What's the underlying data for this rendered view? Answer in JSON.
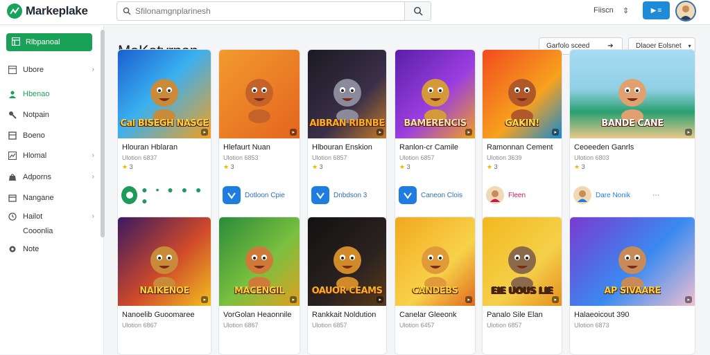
{
  "app": {
    "name": "Markeplake"
  },
  "search": {
    "placeholder": "Sfilonamgnplarinesh",
    "value": ""
  },
  "topbar": {
    "link": "Fiiscn",
    "sort_symbol": "⇕",
    "button_label": "▶",
    "accent": "#1e8bd8"
  },
  "sidebar": {
    "primary": "Rlbpanoal",
    "items": [
      {
        "label": "Ubore",
        "icon": "grid-icon",
        "chevron": true,
        "active": false
      },
      {
        "label": "Hbenao",
        "icon": "user-icon",
        "chevron": false,
        "active": true
      },
      {
        "label": "Notpain",
        "icon": "wrench-icon",
        "chevron": false,
        "active": false
      },
      {
        "label": "Boeno",
        "icon": "box-icon",
        "chevron": false,
        "active": false
      },
      {
        "label": "Hlomal",
        "icon": "chart-icon",
        "chevron": true,
        "active": false
      },
      {
        "label": "Adporns",
        "icon": "bag-icon",
        "chevron": true,
        "active": false
      },
      {
        "label": "Nangane",
        "icon": "calendar-icon",
        "chevron": false,
        "active": false
      },
      {
        "label": "Hailot",
        "icon": "clock-icon",
        "chevron": true,
        "active": false
      },
      {
        "label": "Cooonlia",
        "icon": "none",
        "chevron": false,
        "active": false
      },
      {
        "label": "Note",
        "icon": "gear-icon",
        "chevron": false,
        "active": false
      }
    ]
  },
  "main": {
    "title": "MaKatyrpan",
    "sort_label": "Garfolo sceed",
    "filter_label": "Dlaoer Eolsnet"
  },
  "cards_row1": [
    {
      "title": "Hlouran Hblaran",
      "sub": "Ulotion 6837",
      "rating": "3",
      "thumb_text": "Cal BISEGH NASCE",
      "foot_label": "",
      "foot_type": "dots",
      "foot_color": "#1e9a5c"
    },
    {
      "title": "Hlefaurt Nuan",
      "sub": "Ulotion 6853",
      "rating": "3",
      "thumb_text": "",
      "foot_label": "Dotloon Cpie",
      "foot_type": "app",
      "foot_color": "#1e7de0"
    },
    {
      "title": "Hlbouran Enskion",
      "sub": "Ulotion 6857",
      "rating": "3",
      "thumb_text": "AIBRAN RIBNBE",
      "foot_label": "Dnbdson 3",
      "foot_type": "app",
      "foot_color": "#1e7de0"
    },
    {
      "title": "Ranlon-cr Camile",
      "sub": "Ulotion 6857",
      "rating": "3",
      "thumb_text": "BAMERENCIS",
      "foot_label": "Caneon Clois",
      "foot_type": "app",
      "foot_color": "#1e7de0"
    },
    {
      "title": "Ramonnan Cement",
      "sub": "Ulotion 3639",
      "rating": "3",
      "thumb_text": "GAKIN!",
      "foot_label": "Fleen",
      "foot_type": "avatar",
      "foot_color": "#c2185b"
    },
    {
      "title": "Ceoeeden Ganrls",
      "sub": "Ulotion 6803",
      "rating": "3",
      "thumb_text": "BANDE CANE",
      "foot_label": "Dare Nonik",
      "foot_type": "avatar",
      "foot_color": "#1e7de0"
    }
  ],
  "cards_row2": [
    {
      "title": "Nanoelib Guoomaree",
      "sub": "Ulotion 6867",
      "thumb_text": "NAIKENOE"
    },
    {
      "title": "VorGolan Heaonnile",
      "sub": "Ulotion 6867",
      "thumb_text": "MACENGIL"
    },
    {
      "title": "Rankkait Noldution",
      "sub": "Ulotion 6857",
      "thumb_text": "OAUOR CEAMS"
    },
    {
      "title": "Canelar Gleeonk",
      "sub": "Ulotion 6457",
      "thumb_text": "CANDEBS"
    },
    {
      "title": "Panalo Sile Elan",
      "sub": "Ulotion 6857",
      "thumb_text": "EIE UOUS LIE"
    },
    {
      "title": "Halaeoicout 390",
      "sub": "Ulotion 6873",
      "thumb_text": "AP SIVAARE"
    }
  ]
}
